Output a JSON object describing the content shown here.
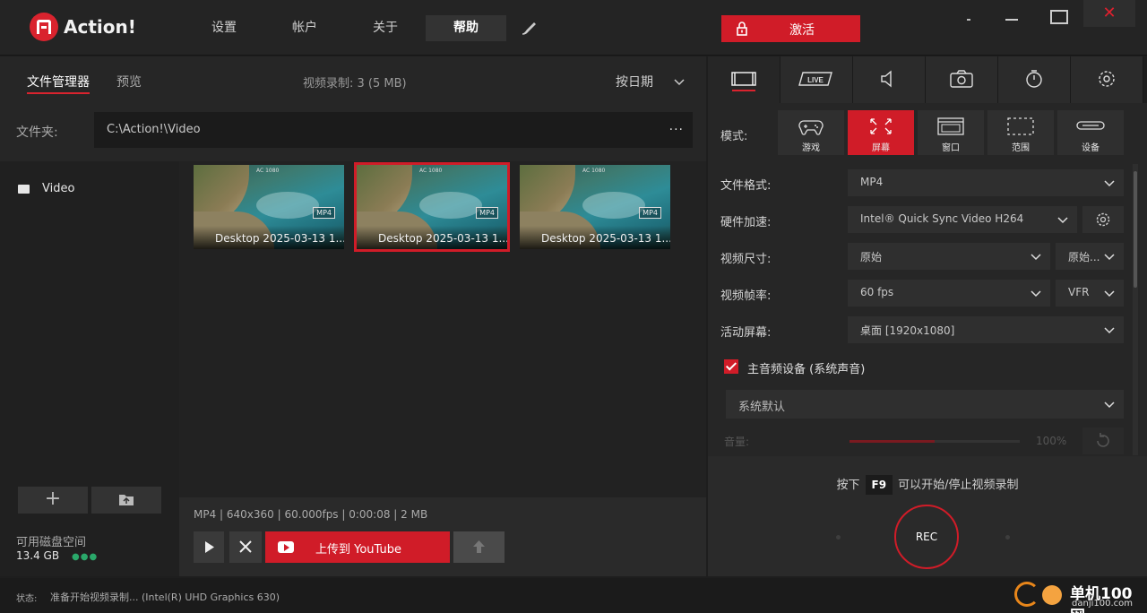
{
  "app": {
    "title": "Action!"
  },
  "topnav": [
    {
      "label": "设置",
      "active": false
    },
    {
      "label": "帐户",
      "active": false
    },
    {
      "label": "关于",
      "active": false
    },
    {
      "label": "帮助",
      "active": true
    }
  ],
  "activate": {
    "label": "激活"
  },
  "left": {
    "tabs": {
      "files": "文件管理器",
      "preview": "预览"
    },
    "rec_count": "视频录制:  3 (5 MB)",
    "sort": "按日期",
    "folder": {
      "label": "文件夹:",
      "path": "C:\\Action!\\Video",
      "more": "..."
    },
    "tree": [
      {
        "label": "Video"
      }
    ],
    "disk": {
      "label": "可用磁盘空间",
      "value": "13.4 GB",
      "dots": "●●●"
    },
    "thumbnails": [
      {
        "caption": "Desktop 2025-03-13 1...",
        "badge": "MP4",
        "selected": false
      },
      {
        "caption": "Desktop 2025-03-13 1...",
        "badge": "MP4",
        "selected": true
      },
      {
        "caption": "Desktop 2025-03-13 1...",
        "badge": "MP4",
        "selected": false
      }
    ],
    "fileinfo": "MP4 | 640x360 | 60.000fps | 0:00:08 | 2 MB",
    "upload_label": "上传到 YouTube"
  },
  "right": {
    "tabs": [
      "video-tab",
      "live-tab",
      "audio-tab",
      "screenshot-tab",
      "timer-tab",
      "settings-tab"
    ],
    "live_text": "LIVE",
    "mode_label": "模式:",
    "modes": [
      {
        "label": "游戏",
        "active": false
      },
      {
        "label": "屏幕",
        "active": true
      },
      {
        "label": "窗口",
        "active": false
      },
      {
        "label": "范围",
        "active": false
      },
      {
        "label": "设备",
        "active": false
      }
    ],
    "settings": {
      "format": {
        "label": "文件格式:",
        "value": "MP4"
      },
      "hwaccel": {
        "label": "硬件加速:",
        "value": "Intel® Quick Sync Video H264"
      },
      "size": {
        "label": "视频尺寸:",
        "value": "原始",
        "value2": "原始..."
      },
      "fps": {
        "label": "视频帧率:",
        "value": "60 fps",
        "value2": "VFR"
      },
      "screen": {
        "label": "活动屏幕:",
        "value": "桌面 [1920x1080]"
      }
    },
    "audio": {
      "checked": true,
      "label": "主音频设备 (系统声音)",
      "device": "系统默认",
      "volume_label": "音量:",
      "volume": "100%",
      "volume_fraction": 0.5
    },
    "hint": {
      "prefix": "按下",
      "key": "F9",
      "suffix": "可以开始/停止视频录制"
    },
    "rec_label": "REC"
  },
  "status": {
    "label": "状态:",
    "text": "准备开始视频录制... (Intel(R) UHD Graphics 630)"
  },
  "watermark": {
    "line1": "单机100网",
    "line2": "danji100.com"
  },
  "colors": {
    "accent": "#d01c28",
    "bg": "#1e1e1e",
    "panel": "#262626"
  }
}
